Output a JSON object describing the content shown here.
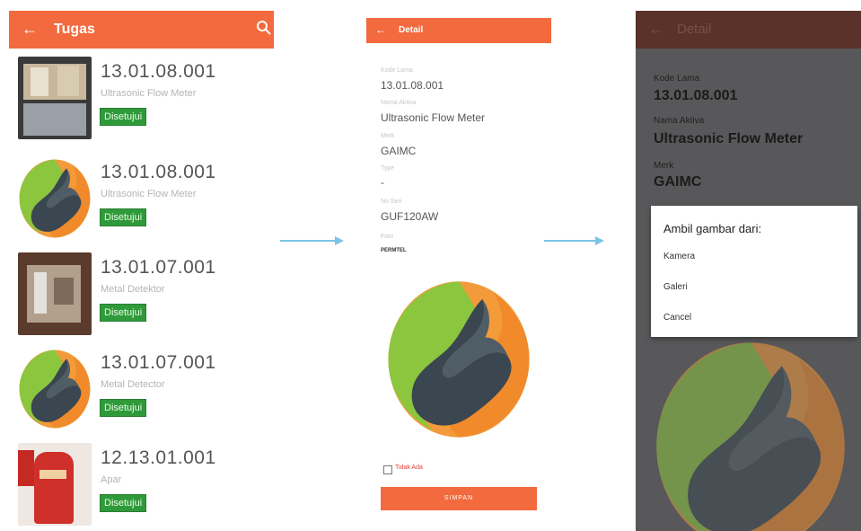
{
  "screen1": {
    "title": "Tugas",
    "back_icon": "back-arrow-icon",
    "search_icon": "search-icon",
    "items": [
      {
        "code": "13.01.08.001",
        "name": "Ultrasonic Flow Meter",
        "status": "Disetujui",
        "thumb": "photo"
      },
      {
        "code": "13.01.08.001",
        "name": "Ultrasonic Flow Meter",
        "status": "Disetujui",
        "thumb": "logo"
      },
      {
        "code": "13.01.07.001",
        "name": "Metal Detektor",
        "status": "Disetujui",
        "thumb": "photo"
      },
      {
        "code": "13.01.07.001",
        "name": "Metal Detector",
        "status": "Disetujui",
        "thumb": "logo"
      },
      {
        "code": "12.13.01.001",
        "name": "Apar",
        "status": "Disetujui",
        "thumb": "photo-red"
      }
    ]
  },
  "screen2": {
    "title": "Detail",
    "back_icon": "back-arrow-icon",
    "fields": [
      {
        "label": "Kode Lama",
        "value": "13.01.08.001"
      },
      {
        "label": "Nama Aktiva",
        "value": "Ultrasonic Flow Meter"
      },
      {
        "label": "Merk",
        "value": "GAIMC"
      },
      {
        "label": "Type",
        "value": "-"
      },
      {
        "label": "No Seri",
        "value": "GUF120AW"
      },
      {
        "label": "Foto",
        "value": "PERMTEL"
      }
    ],
    "checkbox_label": "Tidak Ada",
    "save_label": "SIMPAN"
  },
  "screen3": {
    "title": "Detail",
    "fields": [
      {
        "label": "Kode Lama",
        "value": "13.01.08.001"
      },
      {
        "label": "Nama Aktiva",
        "value": "Ultrasonic Flow Meter"
      },
      {
        "label": "Merk",
        "value": "GAIMC"
      }
    ],
    "dialog": {
      "title": "Ambil gambar dari:",
      "options": [
        "Kamera",
        "Galeri",
        "Cancel"
      ]
    }
  },
  "colors": {
    "appbar": "#f26a3d",
    "badge": "#2f9a3a",
    "arrow": "#7cc4e6",
    "overlay": "#58585a"
  }
}
